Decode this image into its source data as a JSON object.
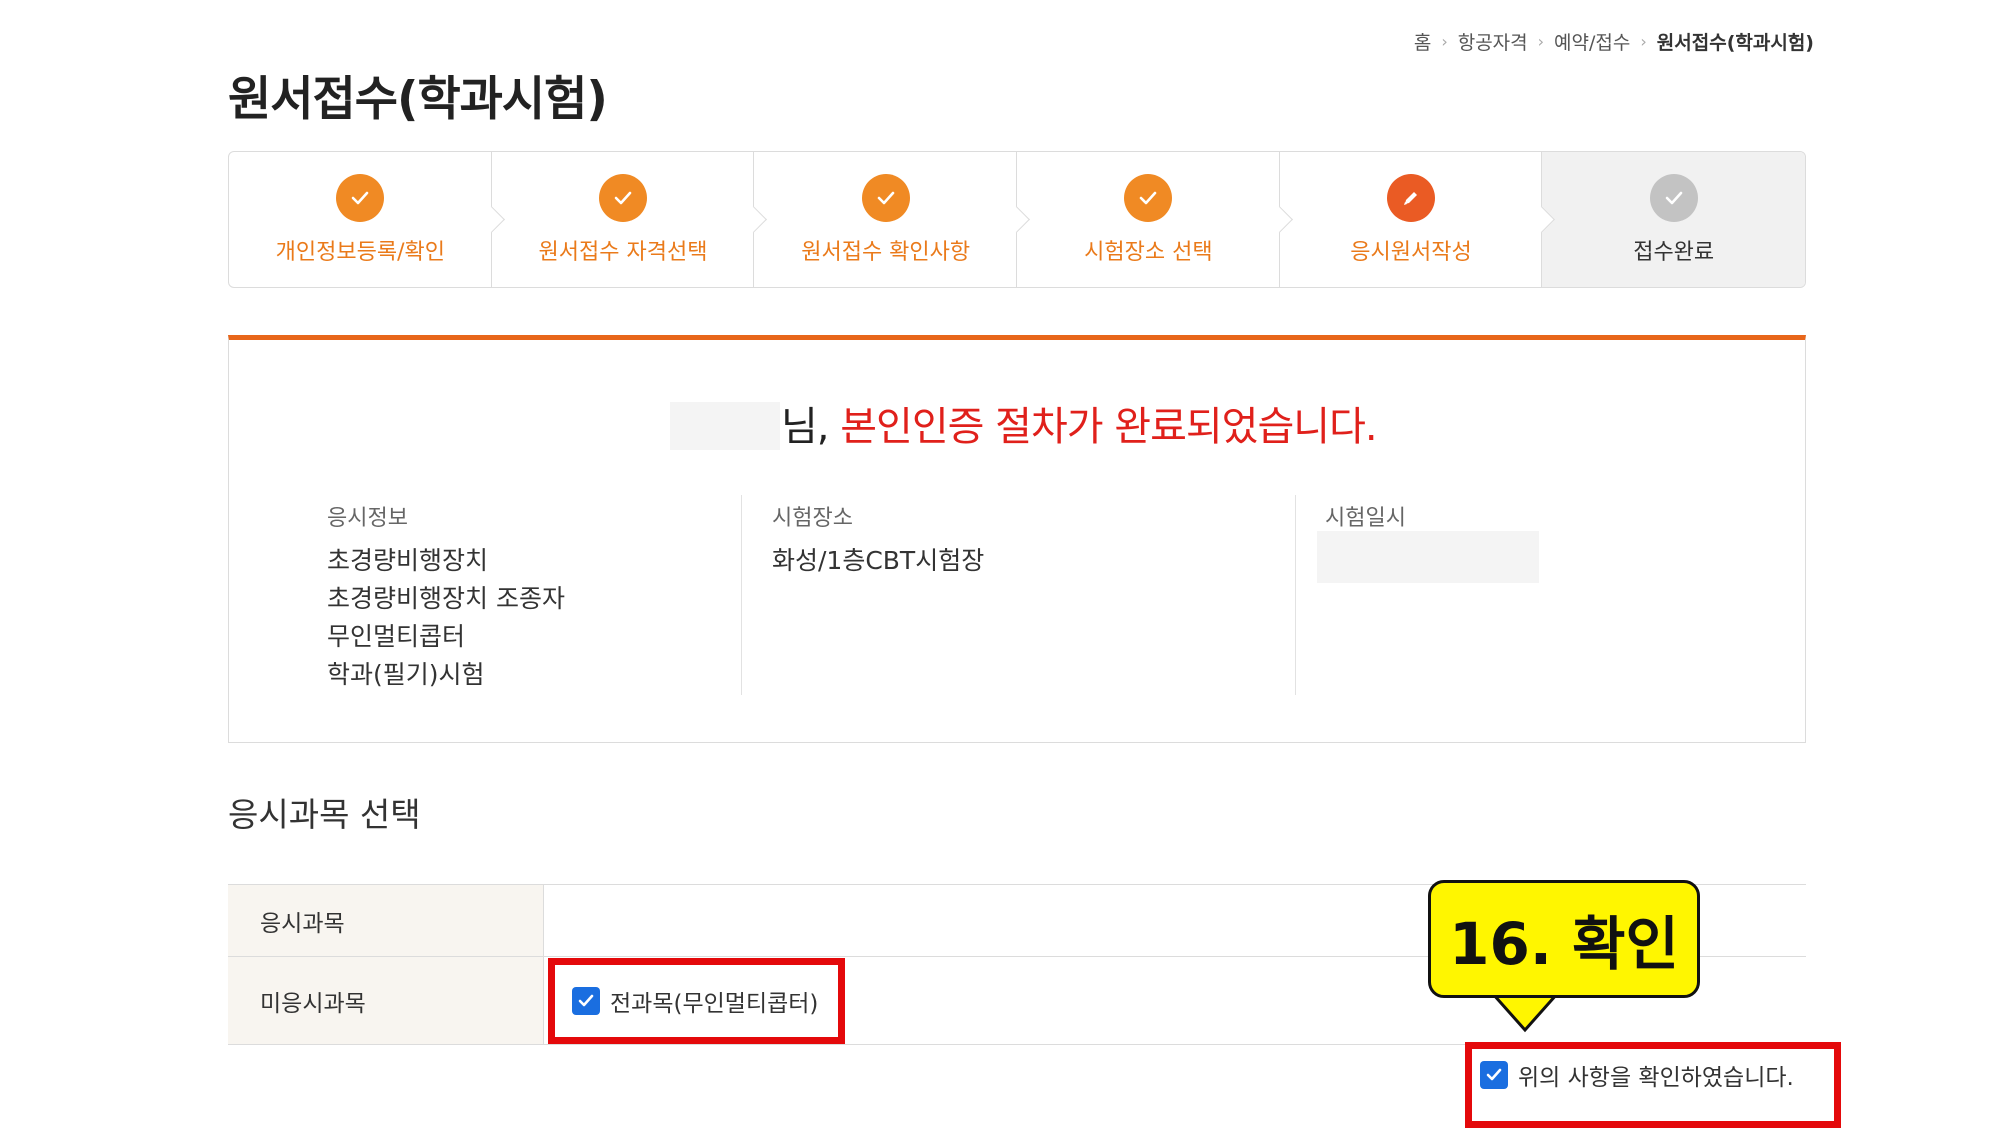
{
  "breadcrumb": {
    "items": [
      "홈",
      "항공자격",
      "예약/접수"
    ],
    "current": "원서접수(학과시험)"
  },
  "page_title": "원서접수(학과시험)",
  "steps": [
    {
      "label": "개인정보등록/확인",
      "state": "done",
      "icon": "check-icon"
    },
    {
      "label": "원서접수 자격선택",
      "state": "done",
      "icon": "check-icon"
    },
    {
      "label": "원서접수 확인사항",
      "state": "done",
      "icon": "check-icon"
    },
    {
      "label": "시험장소 선택",
      "state": "done",
      "icon": "check-icon"
    },
    {
      "label": "응시원서작성",
      "state": "current",
      "icon": "pencil-icon"
    },
    {
      "label": "접수완료",
      "state": "pending",
      "icon": "check-icon"
    }
  ],
  "info": {
    "headline_prefix": "님,",
    "headline_message": "본인인증 절차가 완료되었습니다.",
    "exam_info_label": "응시정보",
    "exam_info_lines": [
      "초경량비행장치",
      "초경량비행장치 조종자",
      "무인멀티콥터",
      "학과(필기)시험"
    ],
    "exam_place_label": "시험장소",
    "exam_place_value": "화성/1층CBT시험장",
    "exam_datetime_label": "시험일시"
  },
  "subject_section": {
    "title": "응시과목 선택",
    "row1_label": "응시과목",
    "row2_label": "미응시과목",
    "all_subjects_label": "전과목(무인멀티콥터)",
    "all_subjects_checked": true
  },
  "confirm": {
    "label": "위의 사항을 확인하였습니다.",
    "checked": true
  },
  "callout": {
    "text": "16. 확인"
  },
  "colors": {
    "accent": "#f08a24",
    "current_step": "#ea5b24",
    "pending_step": "#c3c3c3",
    "highlight": "#e4090b",
    "callout_bg": "#fff600",
    "checkbox": "#1a6ee0"
  }
}
